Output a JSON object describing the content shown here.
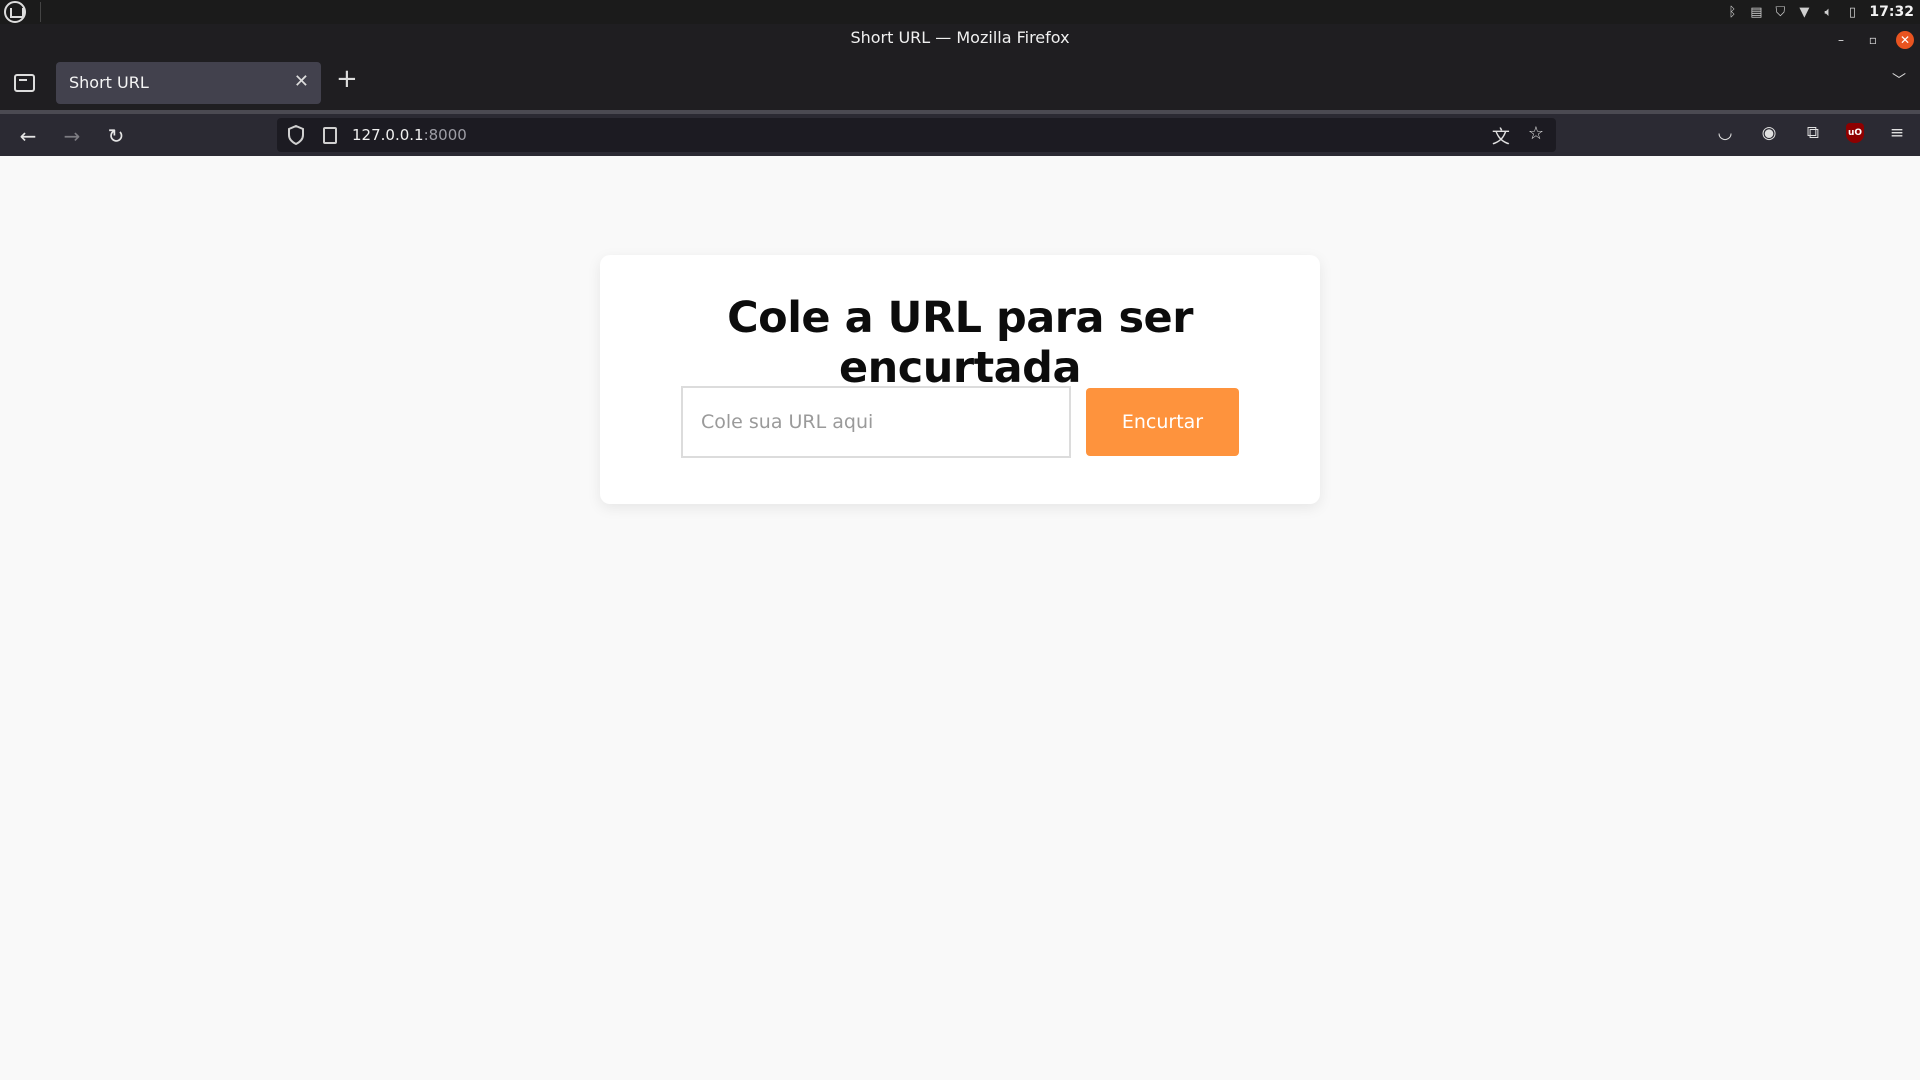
{
  "os_panel": {
    "clock": "17:32",
    "tray_icons": [
      "bluetooth-icon",
      "clipboard-icon",
      "shield-icon",
      "wifi-icon",
      "volume-icon",
      "battery-icon"
    ]
  },
  "window": {
    "title": "Short URL — Mozilla Firefox"
  },
  "tabs": [
    {
      "label": "Short URL",
      "active": true
    }
  ],
  "urlbar": {
    "host": "127.0.0.1",
    "port": ":8000"
  },
  "page": {
    "heading": "Cole a URL para ser encurtada",
    "input_placeholder": "Cole sua URL aqui",
    "input_value": "",
    "button_label": "Encurtar",
    "accent_color": "#fe933d"
  }
}
